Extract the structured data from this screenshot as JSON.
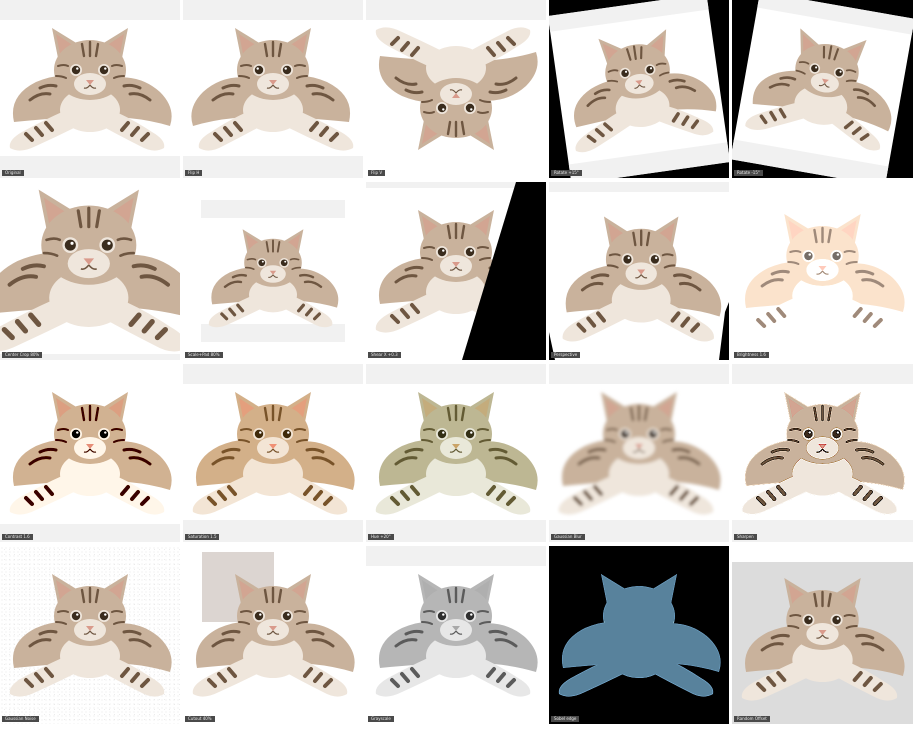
{
  "grid": {
    "rows": 4,
    "columns": 5,
    "subject": "kitten",
    "tiles": [
      {
        "label": "Original",
        "variant": "original"
      },
      {
        "label": "Flip H",
        "variant": "flip-h"
      },
      {
        "label": "Flip V",
        "variant": "flip-v"
      },
      {
        "label": "Rotate +15°",
        "variant": "rotate-pos"
      },
      {
        "label": "Rotate -15°",
        "variant": "rotate-neg"
      },
      {
        "label": "Center Crop 80%",
        "variant": "center-crop"
      },
      {
        "label": "Scale+Pad 80%",
        "variant": "scale-pad"
      },
      {
        "label": "Shear X +0.3",
        "variant": "shear"
      },
      {
        "label": "Perspective",
        "variant": "perspective"
      },
      {
        "label": "Brightness 1.6",
        "variant": "brightness"
      },
      {
        "label": "Contrast 1.6",
        "variant": "contrast"
      },
      {
        "label": "Saturation 1.5",
        "variant": "saturation"
      },
      {
        "label": "Hue +20°",
        "variant": "hue"
      },
      {
        "label": "Gaussian Blur",
        "variant": "blur"
      },
      {
        "label": "Sharpen",
        "variant": "sharpen"
      },
      {
        "label": "Gaussian Noise",
        "variant": "noise"
      },
      {
        "label": "Cutout 40%",
        "variant": "cutout"
      },
      {
        "label": "Grayscale",
        "variant": "grayscale"
      },
      {
        "label": "Sobel edge",
        "variant": "edges"
      },
      {
        "label": "Random Offset",
        "variant": "gray-bg"
      }
    ]
  },
  "colors": {
    "page_background": "#ffffff",
    "padding_band": "#f1f1f1",
    "caption_background": "#4a4a4a",
    "caption_text": "#e8e8e8",
    "cat_fur_base": "#c9b29c",
    "cat_fur_dark": "#6e5641",
    "cat_fur_light": "#efe6dc",
    "cat_eye": "#3a2c1d",
    "cat_nose": "#d99a8b",
    "cutout_patch": "#dcd5d1"
  }
}
